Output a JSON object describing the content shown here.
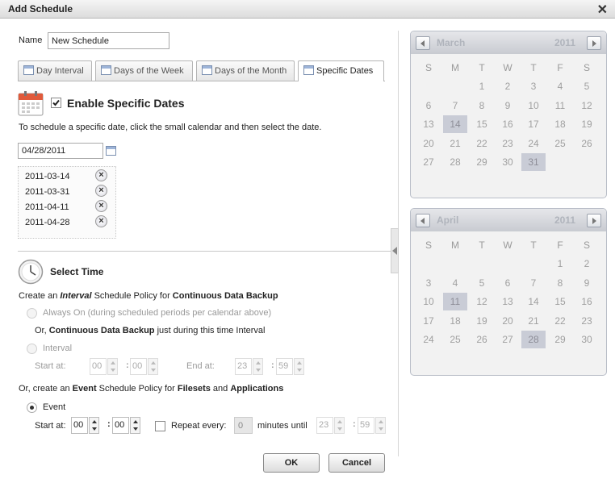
{
  "dialog": {
    "title": "Add Schedule",
    "close_symbol": "✕"
  },
  "name": {
    "label": "Name",
    "value": "New Schedule"
  },
  "tabs": [
    {
      "label": "Day Interval"
    },
    {
      "label": "Days of the Week"
    },
    {
      "label": "Days of the Month"
    },
    {
      "label": "Specific Dates"
    }
  ],
  "active_tab": "Specific Dates",
  "specific": {
    "enable_label": "Enable Specific Dates",
    "enabled": true,
    "instructions": "To schedule a specific date, click the small calendar and then select the date.",
    "date_value": "04/28/2011",
    "dates": [
      "2011-03-14",
      "2011-03-31",
      "2011-04-11",
      "2011-04-28"
    ]
  },
  "time": {
    "section_title": "Select Time",
    "interval_heading": {
      "a": "Create an ",
      "b": "Interval",
      "c": " Schedule Policy for ",
      "d": "Continuous Data Backup"
    },
    "always_on_label": "Always On (during scheduled periods per calendar above)",
    "or_cdp_line": {
      "a": "Or, ",
      "b": "Continuous Data Backup",
      "c": " just during this time Interval"
    },
    "interval_label": "Interval",
    "start_at_label": "Start at:",
    "end_at_label": "End at:",
    "interval_start": {
      "h": "00",
      "m": "00"
    },
    "interval_end": {
      "h": "23",
      "m": "59"
    },
    "event_heading": {
      "a": "Or, create an ",
      "b": "Event",
      "c": " Schedule Policy for ",
      "d": "Filesets",
      "e": " and ",
      "f": "Applications"
    },
    "event_label": "Event",
    "event_selected": true,
    "event_start": {
      "h": "00",
      "m": "00"
    },
    "repeat_label": "Repeat every:",
    "repeat_value": "0",
    "minutes_until_label": "minutes until",
    "until": {
      "h": "23",
      "m": "59"
    },
    "colon": ":"
  },
  "buttons": {
    "ok": "OK",
    "cancel": "Cancel"
  },
  "weekdays": [
    "S",
    "M",
    "T",
    "W",
    "T",
    "F",
    "S"
  ],
  "calendars": [
    {
      "month": "March",
      "year": "2011",
      "weeks": [
        [
          "",
          "",
          "1",
          "2",
          "3",
          "4",
          "5"
        ],
        [
          "6",
          "7",
          "8",
          "9",
          "10",
          "11",
          "12"
        ],
        [
          "13",
          "14",
          "15",
          "16",
          "17",
          "18",
          "19"
        ],
        [
          "20",
          "21",
          "22",
          "23",
          "24",
          "25",
          "26"
        ],
        [
          "27",
          "28",
          "29",
          "30",
          "31",
          "",
          ""
        ]
      ],
      "selected": [
        "14",
        "31"
      ]
    },
    {
      "month": "April",
      "year": "2011",
      "weeks": [
        [
          "",
          "",
          "",
          "",
          "",
          "1",
          "2"
        ],
        [
          "3",
          "4",
          "5",
          "6",
          "7",
          "8",
          "9"
        ],
        [
          "10",
          "11",
          "12",
          "13",
          "14",
          "15",
          "16"
        ],
        [
          "17",
          "18",
          "19",
          "20",
          "21",
          "22",
          "23"
        ],
        [
          "24",
          "25",
          "26",
          "27",
          "28",
          "29",
          "30"
        ]
      ],
      "selected": [
        "11",
        "28"
      ]
    }
  ]
}
